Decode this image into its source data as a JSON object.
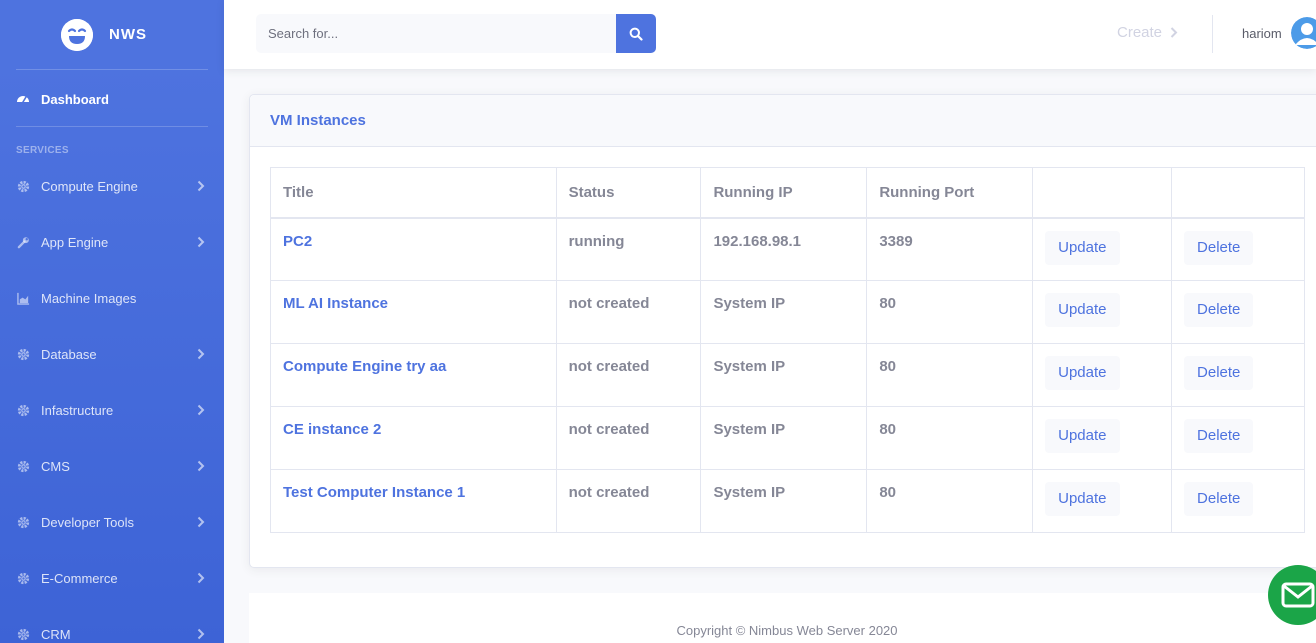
{
  "brand": {
    "name": "NWS",
    "logo_icon": "laughing-face-icon"
  },
  "sidebar": {
    "dashboard": {
      "label": "Dashboard",
      "icon": "tachometer-icon"
    },
    "heading": "SERVICES",
    "items": [
      {
        "label": "Compute Engine",
        "icon": "cog-icon",
        "has_children": true
      },
      {
        "label": "App Engine",
        "icon": "wrench-icon",
        "has_children": true
      },
      {
        "label": "Machine Images",
        "icon": "chart-area-icon",
        "has_children": false
      },
      {
        "label": "Database",
        "icon": "cog-icon",
        "has_children": true
      },
      {
        "label": "Infastructure",
        "icon": "cog-icon",
        "has_children": true
      },
      {
        "label": "CMS",
        "icon": "cog-icon",
        "has_children": true
      },
      {
        "label": "Developer Tools",
        "icon": "cog-icon",
        "has_children": true
      },
      {
        "label": "E-Commerce",
        "icon": "cog-icon",
        "has_children": true
      },
      {
        "label": "CRM",
        "icon": "cog-icon",
        "has_children": true
      }
    ]
  },
  "topbar": {
    "search": {
      "placeholder": "Search for...",
      "value": ""
    },
    "create_label": "Create",
    "user_name": "hariom"
  },
  "card": {
    "title": "VM Instances",
    "columns": [
      "Title",
      "Status",
      "Running IP",
      "Running Port",
      "",
      ""
    ],
    "rows": [
      {
        "title": "PC2",
        "status": "running",
        "ip": "192.168.98.1",
        "port": "3389",
        "update": "Update",
        "delete": "Delete"
      },
      {
        "title": "ML AI Instance",
        "status": "not created",
        "ip": "System IP",
        "port": "80",
        "update": "Update",
        "delete": "Delete"
      },
      {
        "title": "Compute Engine try aa",
        "status": "not created",
        "ip": "System IP",
        "port": "80",
        "update": "Update",
        "delete": "Delete"
      },
      {
        "title": "CE instance 2",
        "status": "not created",
        "ip": "System IP",
        "port": "80",
        "update": "Update",
        "delete": "Delete"
      },
      {
        "title": "Test Computer Instance 1",
        "status": "not created",
        "ip": "System IP",
        "port": "80",
        "update": "Update",
        "delete": "Delete"
      }
    ]
  },
  "footer": {
    "copyright": "Copyright © Nimbus Web Server 2020"
  },
  "colors": {
    "primary": "#4e73df",
    "chat": "#1ba548",
    "text": "#858796"
  }
}
